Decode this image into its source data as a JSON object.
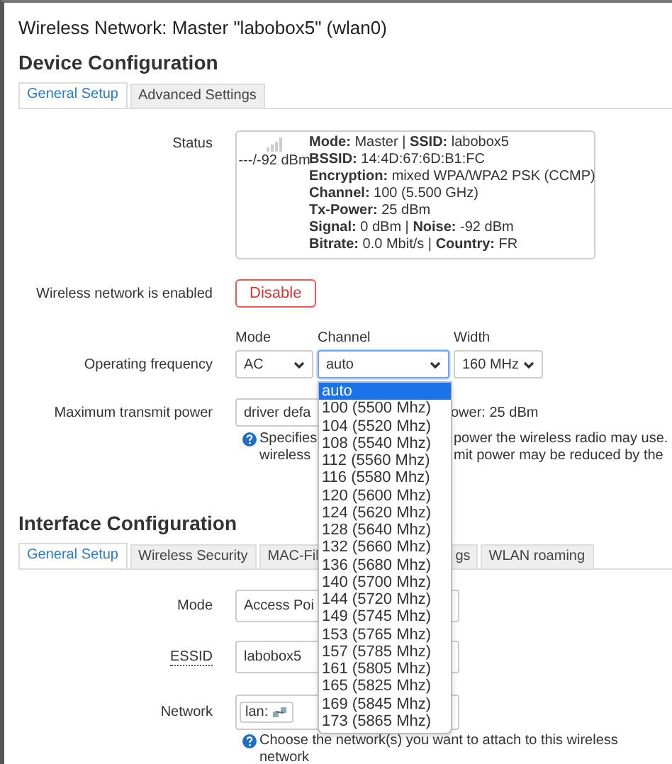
{
  "title": "Wireless Network: Master \"labobox5\" (wlan0)",
  "device_configuration": {
    "heading": "Device Configuration",
    "tabs": [
      {
        "label": "General Setup",
        "selected": true
      },
      {
        "label": "Advanced Settings",
        "selected": false
      }
    ],
    "status": {
      "label": "Status",
      "signal": "---/-92 dBm",
      "lines": [
        "**Mode:** Master | **SSID:** labobox5",
        "**BSSID:** 14:4D:67:6D:B1:FC",
        "**Encryption:** mixed WPA/WPA2 PSK (CCMP)",
        "**Channel:** 100 (5.500 GHz)",
        "**Tx-Power:** 25 dBm",
        "**Signal:** 0 dBm | **Noise:** -92 dBm",
        "**Bitrate:** 0.0 Mbit/s | **Country:** FR"
      ]
    },
    "enabled": {
      "label": "Wireless network is enabled",
      "button": "Disable"
    },
    "frequency": {
      "label": "Operating frequency",
      "fields": [
        {
          "label": "Mode",
          "value": "AC",
          "focused": false
        },
        {
          "label": "Channel",
          "value": "auto",
          "focused": true
        },
        {
          "label": "Width",
          "value": "160 MHz",
          "focused": false
        }
      ]
    },
    "transmit_power": {
      "label": "Maximum transmit power",
      "value": "driver defa",
      "note": "ower: 25 dBm",
      "help_left": [
        "Specifies",
        "wireless"
      ],
      "help_right": [
        "power the wireless radio may use.",
        "mit power may be reduced by the"
      ]
    }
  },
  "channel_dropdown": {
    "options": [
      {
        "label": "auto",
        "selected": true
      },
      {
        "label": "100 (5500 Mhz)",
        "selected": false
      },
      {
        "label": "104 (5520 Mhz)",
        "selected": false
      },
      {
        "label": "108 (5540 Mhz)",
        "selected": false
      },
      {
        "label": "112 (5560 Mhz)",
        "selected": false
      },
      {
        "label": "116 (5580 Mhz)",
        "selected": false
      },
      {
        "label": "120 (5600 Mhz)",
        "selected": false
      },
      {
        "label": "124 (5620 Mhz)",
        "selected": false
      },
      {
        "label": "128 (5640 Mhz)",
        "selected": false
      },
      {
        "label": "132 (5660 Mhz)",
        "selected": false
      },
      {
        "label": "136 (5680 Mhz)",
        "selected": false
      },
      {
        "label": "140 (5700 Mhz)",
        "selected": false
      },
      {
        "label": "144 (5720 Mhz)",
        "selected": false
      },
      {
        "label": "149 (5745 Mhz)",
        "selected": false
      },
      {
        "label": "153 (5765 Mhz)",
        "selected": false
      },
      {
        "label": "157 (5785 Mhz)",
        "selected": false
      },
      {
        "label": "161 (5805 Mhz)",
        "selected": false
      },
      {
        "label": "165 (5825 Mhz)",
        "selected": false
      },
      {
        "label": "169 (5845 Mhz)",
        "selected": false
      },
      {
        "label": "173 (5865 Mhz)",
        "selected": false
      }
    ]
  },
  "interface_configuration": {
    "heading": "Interface Configuration",
    "tabs": [
      {
        "label": "General Setup",
        "selected": true
      },
      {
        "label": "Wireless Security",
        "selected": false
      },
      {
        "label": "MAC-Fil",
        "selected": false
      },
      {
        "label": "gs",
        "selected": false
      },
      {
        "label": "WLAN roaming",
        "selected": false
      }
    ],
    "mode": {
      "label": "Mode",
      "value": "Access Poi"
    },
    "essid": {
      "label": "ESSID",
      "value": "labobox5"
    },
    "network": {
      "label": "Network",
      "value": "lan:",
      "help": "Choose the network(s) you want to attach to this wireless",
      "help_more": "network"
    }
  }
}
